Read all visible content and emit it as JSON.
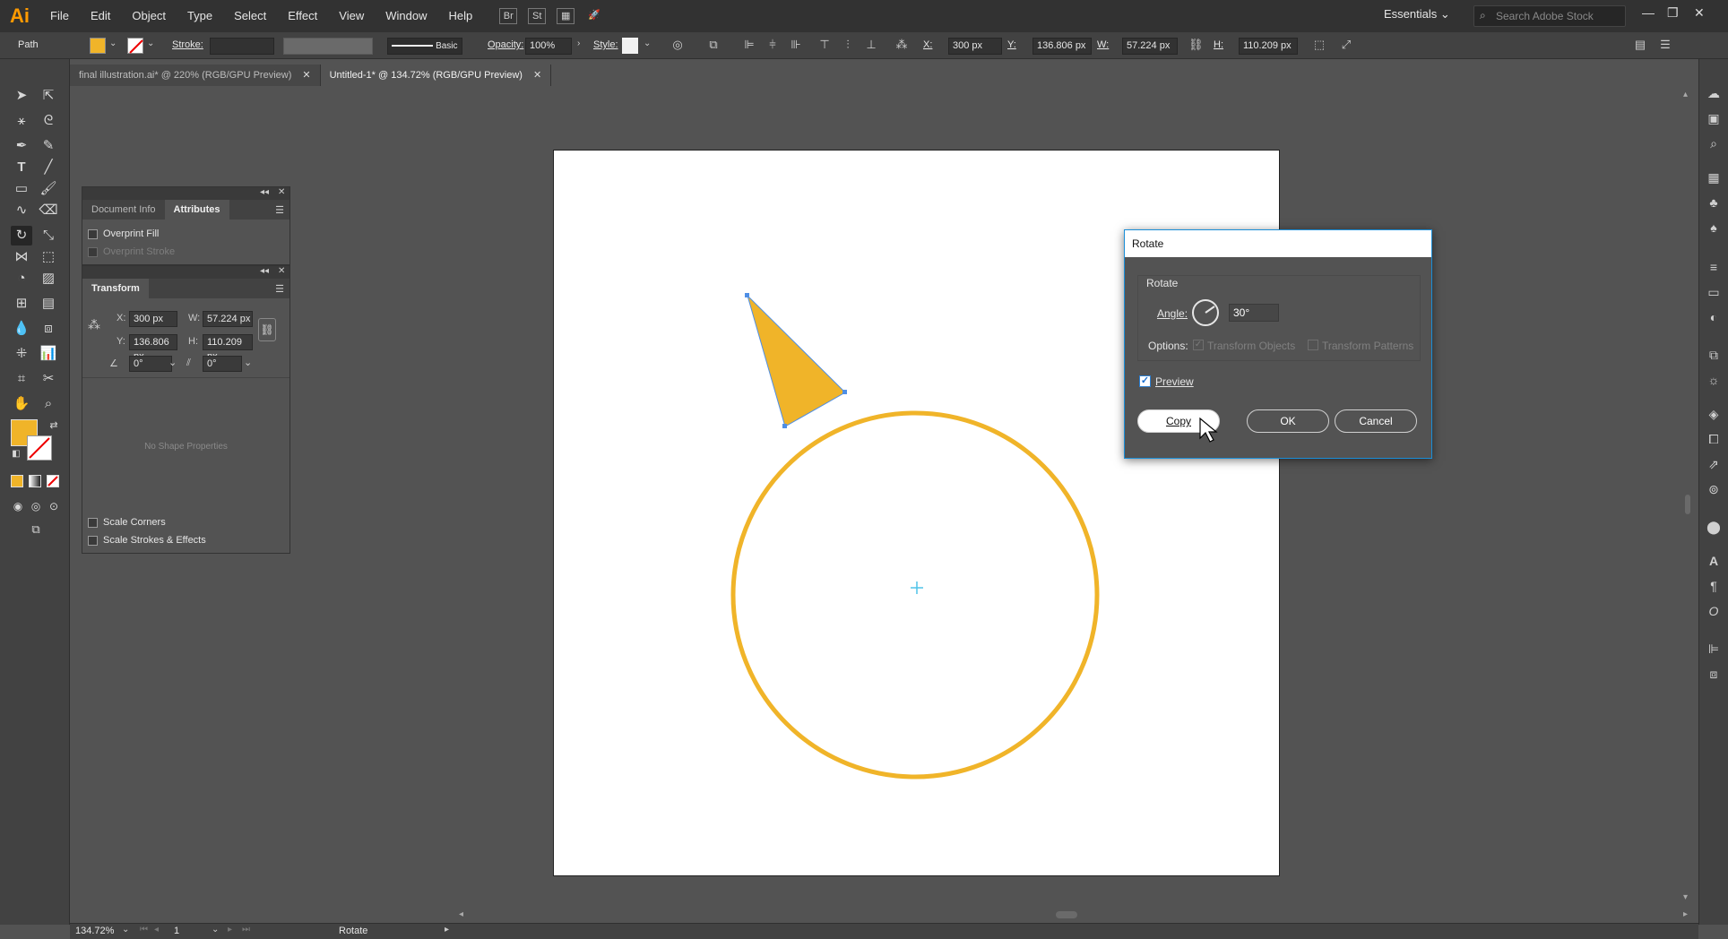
{
  "app": {
    "logo": "Ai",
    "menu": [
      "File",
      "Edit",
      "Object",
      "Type",
      "Select",
      "Effect",
      "View",
      "Window",
      "Help"
    ],
    "bridge_label": "Br",
    "stock_label": "St",
    "workspace": "Essentials",
    "search_placeholder": "Search Adobe Stock",
    "window_controls": {
      "minimize": "—",
      "restore": "❐",
      "close": "✕"
    }
  },
  "control_bar": {
    "selection_type": "Path",
    "fill_color": "#F0B429",
    "stroke_label": "Stroke:",
    "brush_label": "Basic",
    "opacity_label": "Opacity:",
    "opacity_value": "100%",
    "style_label": "Style:",
    "x_label": "X:",
    "x_value": "300 px",
    "y_label": "Y:",
    "y_value": "136.806 px",
    "w_label": "W:",
    "w_value": "57.224 px",
    "h_label": "H:",
    "h_value": "110.209 px"
  },
  "tabs": [
    {
      "label": "final illustration.ai* @ 220% (RGB/GPU Preview)",
      "close": "✕",
      "active": false
    },
    {
      "label": "Untitled-1* @ 134.72% (RGB/GPU Preview)",
      "close": "✕",
      "active": true
    }
  ],
  "attributes_panel": {
    "tabs": [
      "Document Info",
      "Attributes"
    ],
    "active_tab": "Attributes",
    "overprint_fill": "Overprint Fill",
    "overprint_stroke": "Overprint Stroke"
  },
  "transform_panel": {
    "title": "Transform",
    "x_label": "X:",
    "x_value": "300 px",
    "y_label": "Y:",
    "y_value": "136.806 px",
    "w_label": "W:",
    "w_value": "57.224 px",
    "h_label": "H:",
    "h_value": "110.209 px",
    "rotate_value": "0°",
    "shear_value": "0°",
    "no_shape": "No Shape Properties",
    "scale_corners": "Scale Corners",
    "scale_strokes": "Scale Strokes & Effects"
  },
  "artwork": {
    "accent": "#F0B429",
    "selection_color": "#4F8FE6"
  },
  "rotate_dialog": {
    "title": "Rotate",
    "group_label": "Rotate",
    "angle_label": "Angle:",
    "angle_value": "30°",
    "options_label": "Options:",
    "transform_objects": "Transform Objects",
    "transform_patterns": "Transform Patterns",
    "preview_label": "Preview",
    "preview_checked": true,
    "copy_button": "Copy",
    "ok_button": "OK",
    "cancel_button": "Cancel"
  },
  "status_bar": {
    "zoom": "134.72%",
    "artboard_number": "1",
    "tool_name": "Rotate"
  }
}
